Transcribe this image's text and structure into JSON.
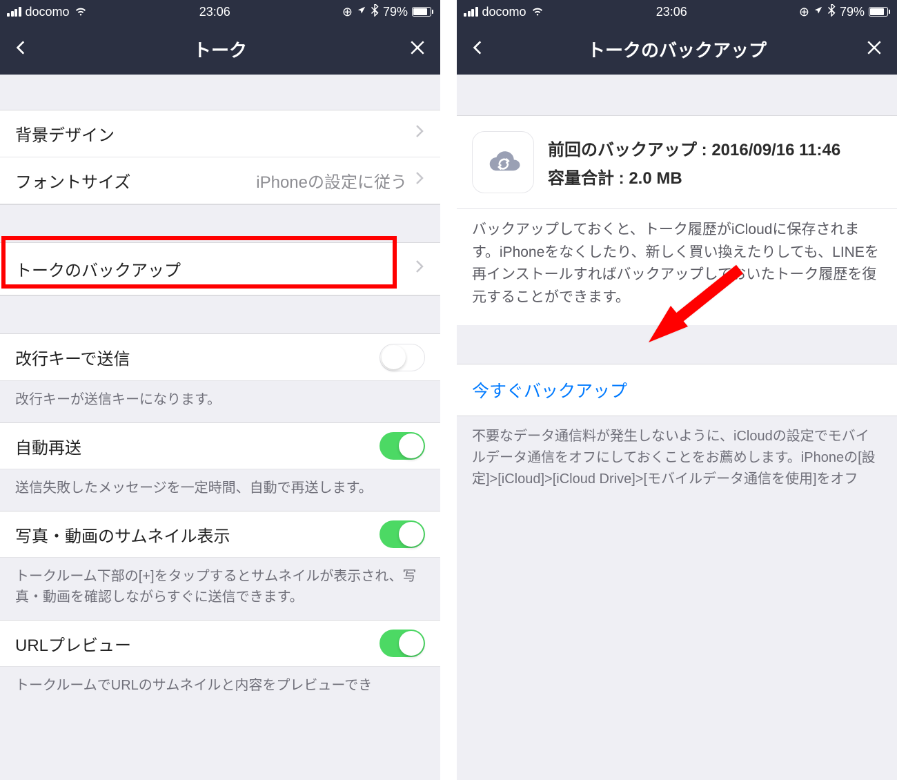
{
  "status": {
    "carrier": "docomo",
    "time": "23:06",
    "battery_pct": "79%"
  },
  "left": {
    "nav_title": "トーク",
    "rows": {
      "background_design": "背景デザイン",
      "font_size_label": "フォントサイズ",
      "font_size_value": "iPhoneの設定に従う",
      "talk_backup": "トークのバックアップ",
      "enter_send_label": "改行キーで送信",
      "enter_send_footer": "改行キーが送信キーになります。",
      "auto_resend_label": "自動再送",
      "auto_resend_footer": "送信失敗したメッセージを一定時間、自動で再送します。",
      "thumbnail_label": "写真・動画のサムネイル表示",
      "thumbnail_footer": "トークルーム下部の[+]をタップするとサムネイルが表示され、写真・動画を確認しながらすぐに送信できます。",
      "url_preview_label": "URLプレビュー",
      "url_preview_footer": "トークルームでURLのサムネイルと内容をプレビューでき"
    },
    "toggles": {
      "enter_send": false,
      "auto_resend": true,
      "thumbnail": true,
      "url_preview": true
    }
  },
  "right": {
    "nav_title": "トークのバックアップ",
    "last_backup_label": "前回のバックアップ : 2016/09/16 11:46",
    "size_label": "容量合計 : 2.0 MB",
    "description": "バックアップしておくと、トーク履歴がiCloudに保存されます。iPhoneをなくしたり、新しく買い換えたりしても、LINEを再インストールすればバックアップしておいたトーク履歴を復元することができます。",
    "backup_now": "今すぐバックアップ",
    "warning": "不要なデータ通信料が発生しないように、iCloudの設定でモバイルデータ通信をオフにしておくことをお薦めします。iPhoneの[設定]>[iCloud]>[iCloud Drive]>[モバイルデータ通信を使用]をオフ"
  }
}
